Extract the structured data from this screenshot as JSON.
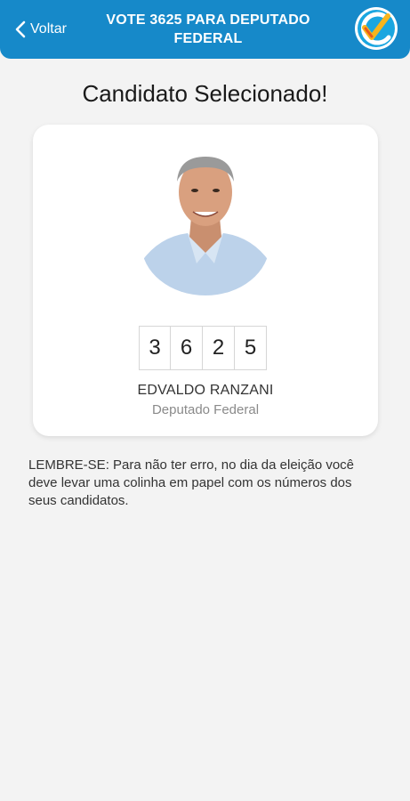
{
  "header": {
    "back_label": "Voltar",
    "title": "VOTE 3625 PARA DEPUTADO FEDERAL",
    "accent_color": "#1689c9"
  },
  "page": {
    "title": "Candidato Selecionado!"
  },
  "candidate": {
    "digits": [
      "3",
      "6",
      "2",
      "5"
    ],
    "name": "EDVALDO RANZANI",
    "role": "Deputado Federal"
  },
  "reminder": {
    "text": "LEMBRE-SE: Para não ter erro, no dia da eleição você deve levar uma colinha em papel com os números dos seus candidatos."
  },
  "icons": {
    "back": "chevron-left-icon",
    "logo": "checkmark-logo-icon"
  }
}
